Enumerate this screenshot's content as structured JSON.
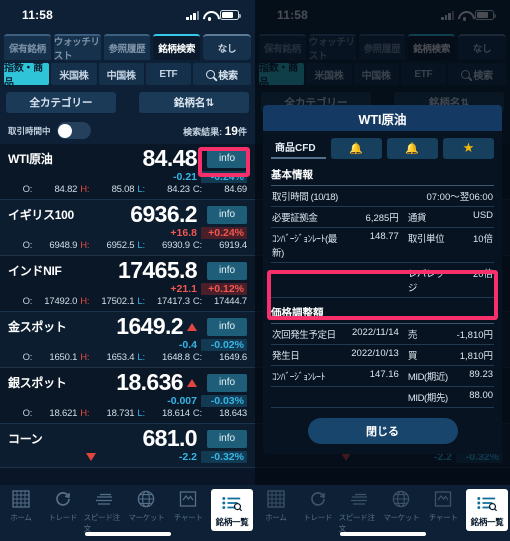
{
  "statusbar": {
    "time": "11:58"
  },
  "top_tabs": [
    {
      "label": "保有銘柄",
      "active": false
    },
    {
      "label": "ウォッチリスト",
      "active": false
    },
    {
      "label": "参照履歴",
      "active": false
    },
    {
      "label": "銘柄検索",
      "active": true
    },
    {
      "label": "なし",
      "active": false,
      "kind": "none"
    }
  ],
  "categories": [
    {
      "label": "指数・商品",
      "selected": true
    },
    {
      "label": "米国株",
      "selected": false
    },
    {
      "label": "中国株",
      "selected": false
    },
    {
      "label": "ETF",
      "selected": false
    },
    {
      "label": "検索",
      "selected": false,
      "icon": "search-icon"
    }
  ],
  "filters": {
    "all_category": "全カテゴリー",
    "sort": "銘柄名⇅"
  },
  "toggle": {
    "label": "取引時間中",
    "result_prefix": "検索結果:",
    "result_count": "19",
    "result_suffix": "件"
  },
  "quotes": [
    {
      "name": "WTI原油",
      "price": "84.48",
      "arrow": "none",
      "change": "-0.21",
      "pct": "-0.24%",
      "dir": "down",
      "o": "84.82",
      "h": "85.08",
      "l": "84.23",
      "c": "84.69",
      "info": "info",
      "highlight": true
    },
    {
      "name": "イギリス100",
      "price": "6936.2",
      "arrow": "none",
      "change": "+16.8",
      "pct": "+0.24%",
      "dir": "up",
      "o": "6948.9",
      "h": "6952.5",
      "l": "6930.9",
      "c": "6919.4",
      "info": "info",
      "highlight": false
    },
    {
      "name": "インドNIF",
      "price": "17465.8",
      "arrow": "none",
      "change": "+21.1",
      "pct": "+0.12%",
      "dir": "up",
      "o": "17492.0",
      "h": "17502.1",
      "l": "17417.3",
      "c": "17444.7",
      "info": "info",
      "highlight": false
    },
    {
      "name": "金スポット",
      "price": "1649.2",
      "arrow": "up",
      "change": "-0.4",
      "pct": "-0.02%",
      "dir": "down",
      "o": "1650.1",
      "h": "1653.4",
      "l": "1648.8",
      "c": "1649.6",
      "info": "info",
      "highlight": false
    },
    {
      "name": "銀スポット",
      "price": "18.636",
      "arrow": "up",
      "change": "-0.007",
      "pct": "-0.03%",
      "dir": "down",
      "o": "18.621",
      "h": "18.731",
      "l": "18.614",
      "c": "18.643",
      "info": "info",
      "highlight": false
    },
    {
      "name": "コーン",
      "price": "681.0",
      "arrow": "down",
      "change": "-2.2",
      "pct": "-0.32%",
      "dir": "down",
      "o": "",
      "h": "",
      "l": "",
      "c": "",
      "info": "info",
      "highlight": false
    }
  ],
  "ohlc_labels": {
    "o": "O:",
    "h": "H:",
    "l": "L:",
    "c": "C:"
  },
  "bottom_nav": [
    {
      "label": "ホーム",
      "icon": "grid-icon",
      "active": false
    },
    {
      "label": "トレード",
      "icon": "refresh-icon",
      "active": false
    },
    {
      "label": "スピード注文",
      "icon": "speed-icon",
      "active": false
    },
    {
      "label": "マーケット",
      "icon": "globe-icon",
      "active": false
    },
    {
      "label": "チャート",
      "icon": "chart-icon",
      "active": false
    },
    {
      "label": "銘柄一覧",
      "icon": "list-search-icon",
      "active": true
    }
  ],
  "modal": {
    "title": "WTI原油",
    "cfd_tag": "商品CFD",
    "bell_icon": "bell-icon",
    "bell_slash_icon": "bell-alert-icon",
    "star_icon": "star-icon",
    "basic_section": "基本情報",
    "basic_rows": [
      {
        "k1": "取引時間 (10/18)",
        "v1": "",
        "k2": "",
        "v2": "07:00〜翌06:00",
        "span": true
      },
      {
        "k1": "必要証拠金",
        "v1": "6,285円",
        "k2": "通貨",
        "v2": "USD"
      },
      {
        "k1": "ｺﾝﾊﾞｰｼﾞｮﾝﾚｰﾄ(最新)",
        "v1": "148.77",
        "k2": "取引単位",
        "v2": "10倍"
      },
      {
        "k1": "",
        "v1": "",
        "k2": "レバレッジ",
        "v2": "20倍"
      }
    ],
    "price_adj_section": "価格調整額",
    "price_adj_rows": [
      {
        "k1": "次回発生予定日",
        "v1": "2022/11/14",
        "k2": "売",
        "v2": "-1,810円"
      },
      {
        "k1": "発生日",
        "v1": "2022/10/13",
        "k2": "買",
        "v2": "1,810円"
      },
      {
        "k1": "ｺﾝﾊﾞｰｼﾞｮﾝﾚｰﾄ",
        "v1": "147.16",
        "k2": "MID(期近)",
        "v2": "89.23"
      },
      {
        "k1": "",
        "v1": "",
        "k2": "MID(期先)",
        "v2": "88.00"
      }
    ],
    "close_label": "閉じる"
  },
  "colors": {
    "accent_cyan": "#2fc4d8",
    "up_red": "#f2564e",
    "down_blue": "#35b6e8",
    "highlight_pink": "#f72f6b",
    "star_gold": "#f5b60c"
  }
}
